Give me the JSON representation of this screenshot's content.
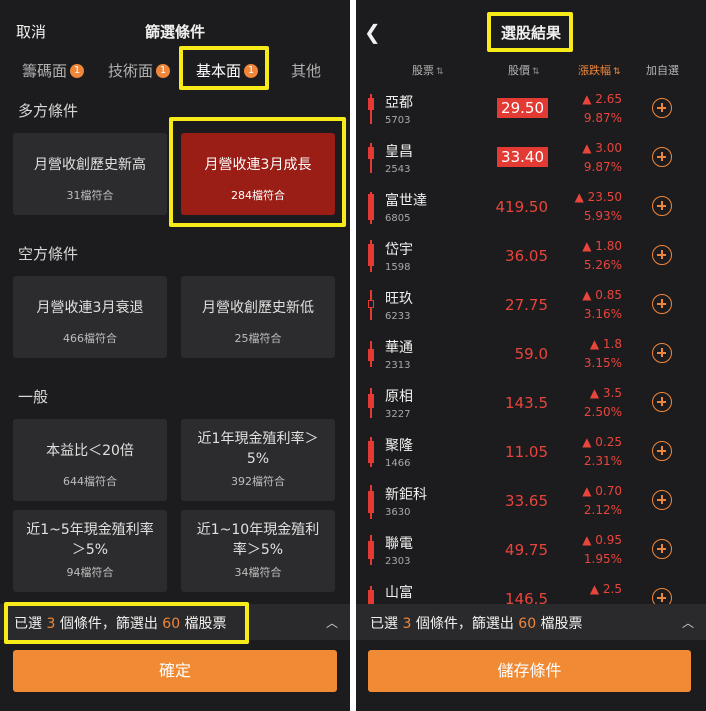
{
  "left": {
    "header": {
      "cancel": "取消",
      "title": "篩選條件"
    },
    "tabs": [
      {
        "label": "籌碼面",
        "badge": "1"
      },
      {
        "label": "技術面",
        "badge": "1"
      },
      {
        "label": "基本面",
        "badge": "1"
      },
      {
        "label": "其他",
        "badge": ""
      }
    ],
    "sections": [
      {
        "title": "多方條件",
        "cards": [
          {
            "label": "月營收創歷史新高",
            "count": "31檔符合"
          },
          {
            "label": "月營收連3月成長",
            "count": "284檔符合",
            "selected": true
          }
        ]
      },
      {
        "title": "空方條件",
        "cards": [
          {
            "label": "月營收連3月衰退",
            "count": "466檔符合"
          },
          {
            "label": "月營收創歷史新低",
            "count": "25檔符合"
          }
        ]
      },
      {
        "title": "一般",
        "cards": [
          {
            "label": "本益比＜20倍",
            "count": "644檔符合"
          },
          {
            "label": "近1年現金殖利率＞5%",
            "count": "392檔符合"
          },
          {
            "label": "近1~5年現金殖利率＞5%",
            "count": "94檔符合"
          },
          {
            "label": "近1~10年現金殖利率＞5%",
            "count": "34檔符合"
          }
        ]
      }
    ],
    "summary": {
      "prefix": "已選 ",
      "selected": "3",
      "middle": " 個條件，篩選出 ",
      "result": "60",
      "suffix": " 檔股票"
    },
    "confirm": "確定"
  },
  "right": {
    "title": "選股結果",
    "columns": {
      "stock": "股票",
      "price": "股價",
      "change": "漲跌幅",
      "add": "加自選"
    },
    "rows": [
      {
        "name": "亞都",
        "code": "5703",
        "price": "29.50",
        "change": "▲ 2.65",
        "pct": "9.87%",
        "limit": true
      },
      {
        "name": "皇昌",
        "code": "2543",
        "price": "33.40",
        "change": "▲ 3.00",
        "pct": "9.87%",
        "limit": true
      },
      {
        "name": "富世達",
        "code": "6805",
        "price": "419.50",
        "change": "▲ 23.50",
        "pct": "5.93%"
      },
      {
        "name": "岱宇",
        "code": "1598",
        "price": "36.05",
        "change": "▲ 1.80",
        "pct": "5.26%"
      },
      {
        "name": "旺玖",
        "code": "6233",
        "price": "27.75",
        "change": "▲ 0.85",
        "pct": "3.16%"
      },
      {
        "name": "華通",
        "code": "2313",
        "price": "59.0",
        "change": "▲ 1.8",
        "pct": "3.15%"
      },
      {
        "name": "原相",
        "code": "3227",
        "price": "143.5",
        "change": "▲ 3.5",
        "pct": "2.50%"
      },
      {
        "name": "聚隆",
        "code": "1466",
        "price": "11.05",
        "change": "▲ 0.25",
        "pct": "2.31%"
      },
      {
        "name": "新鉅科",
        "code": "3630",
        "price": "33.65",
        "change": "▲ 0.70",
        "pct": "2.12%"
      },
      {
        "name": "聯電",
        "code": "2303",
        "price": "49.75",
        "change": "▲ 0.95",
        "pct": "1.95%"
      },
      {
        "name": "山富",
        "code": "",
        "price": "146.5",
        "change": "▲ 2.5",
        "pct": ""
      }
    ],
    "summary": {
      "prefix": "已選 ",
      "selected": "3",
      "middle": " 個條件，篩選出 ",
      "result": "60",
      "suffix": " 檔股票"
    },
    "save": "儲存條件"
  }
}
